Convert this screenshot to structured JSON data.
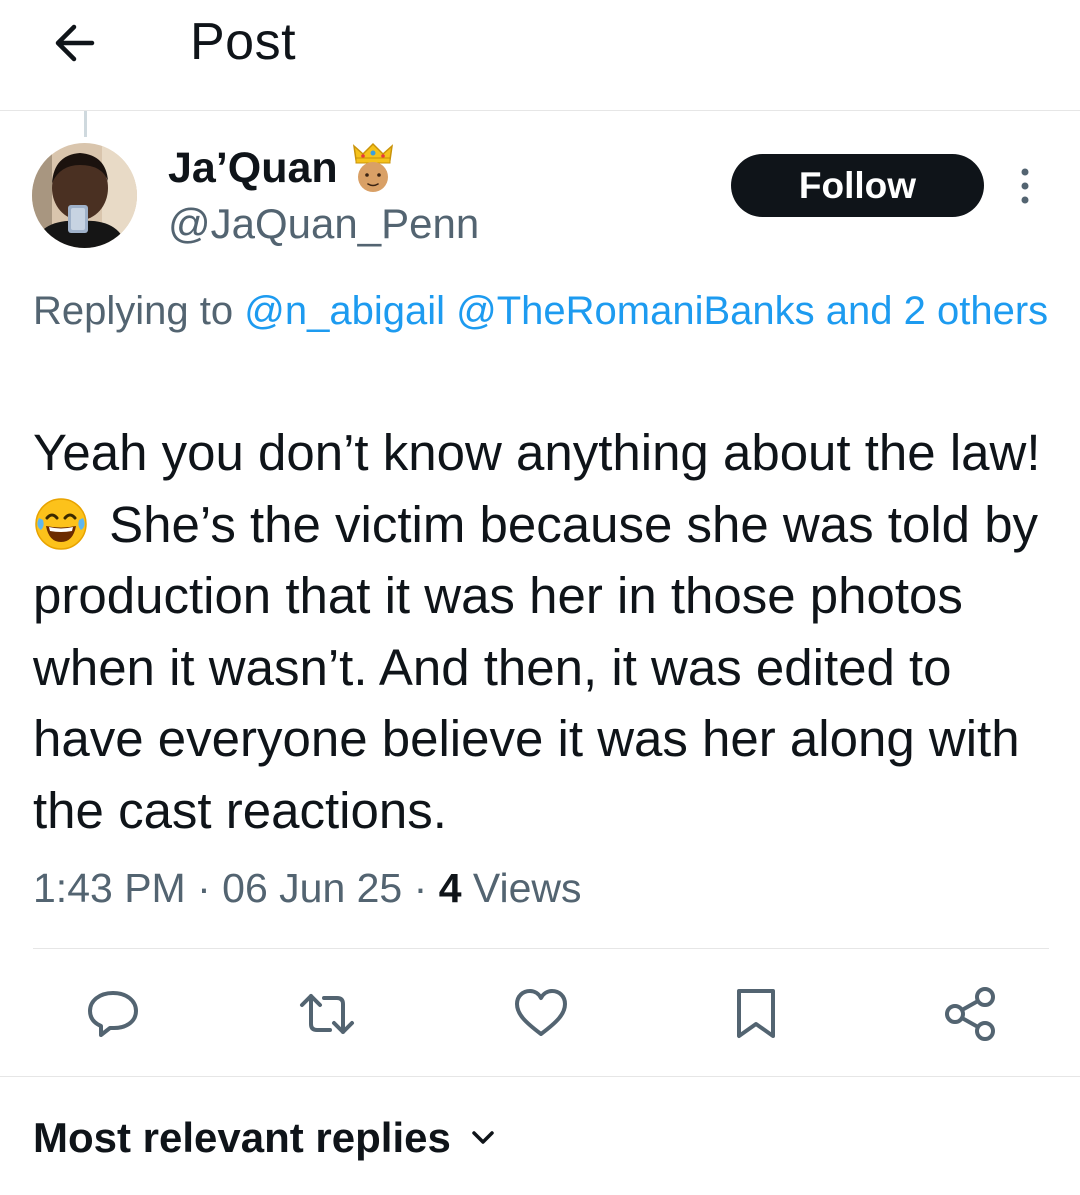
{
  "header": {
    "title": "Post",
    "back_icon": "arrow-left-icon"
  },
  "author": {
    "name": "Ja’Quan",
    "handle": "@JaQuan_Penn",
    "badge_icon": "crown-person-emoji-icon"
  },
  "follow_label": "Follow",
  "reply_context": {
    "prefix": "Replying to ",
    "mention1": "@n_abigail",
    "mention2": "@TheRomaniBanks",
    "others": "and 2 others"
  },
  "tweet": {
    "line1": "Yeah you don’t know anything about the law!",
    "emoji": "face-with-tears-of-joy-icon",
    "line2": " She’s the victim because she was told by production that it was her in those photos when it wasn’t. And then, it was edited to have everyone believe it was her along with the cast reactions."
  },
  "meta": {
    "time": "1:43 PM",
    "sep": " · ",
    "date": "06 Jun 25",
    "views_count": "4",
    "views_label": "Views"
  },
  "actions": [
    "reply-icon",
    "retweet-icon",
    "like-icon",
    "bookmark-icon",
    "share-icon"
  ],
  "replies_filter": {
    "label": "Most relevant replies"
  },
  "colors": {
    "text": "#0f1419",
    "secondary": "#536471",
    "link": "#1d9bf0",
    "divider": "#e6e6e6"
  }
}
